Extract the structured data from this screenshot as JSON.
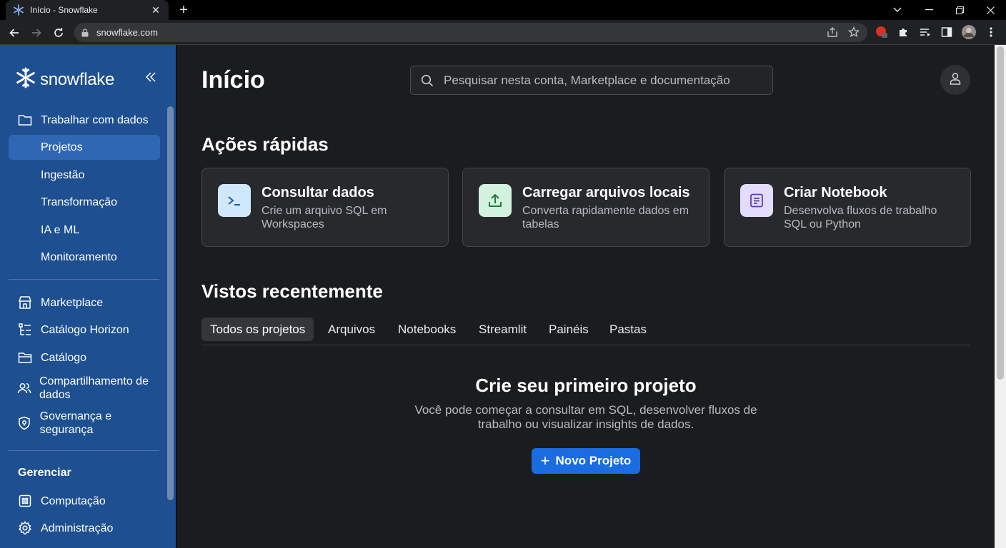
{
  "browser": {
    "tab_title": "Início - Snowflake",
    "url": "snowflake.com"
  },
  "sidebar": {
    "brand": "snowflake",
    "work_with_data": "Trabalhar com dados",
    "sub_items": [
      "Projetos",
      "Ingestão",
      "Transformação",
      "IA e ML",
      "Monitoramento"
    ],
    "items": [
      "Marketplace",
      "Catálogo Horizon",
      "Catálogo",
      "Compartilhamento de dados",
      "Governança e segurança"
    ],
    "manage_label": "Gerenciar",
    "manage_items": [
      "Computação",
      "Administração"
    ]
  },
  "header": {
    "title": "Início",
    "search_placeholder": "Pesquisar nesta conta, Marketplace e documentação"
  },
  "quick_actions": {
    "heading": "Ações rápidas",
    "cards": [
      {
        "title": "Consultar dados",
        "desc": "Crie um arquivo SQL em Workspaces",
        "icon": "terminal-icon",
        "icon_bg": "#cfe8fb",
        "icon_color": "#1f5fa8"
      },
      {
        "title": "Carregar arquivos locais",
        "desc": "Converta rapidamente dados em tabelas",
        "icon": "upload-icon",
        "icon_bg": "#d3f2de",
        "icon_color": "#1f7a45"
      },
      {
        "title": "Criar Notebook",
        "desc": "Desenvolva fluxos de trabalho SQL ou Python",
        "icon": "notebook-icon",
        "icon_bg": "#e3dcfb",
        "icon_color": "#5a3fb0"
      }
    ]
  },
  "recent": {
    "heading": "Vistos recentemente",
    "tabs": [
      "Todos os projetos",
      "Arquivos",
      "Notebooks",
      "Streamlit",
      "Painéis",
      "Pastas"
    ],
    "active_tab": "Todos os projetos",
    "empty_title": "Crie seu primeiro projeto",
    "empty_desc": "Você pode começar a consultar em SQL, desenvolver fluxos de trabalho ou visualizar insights de dados.",
    "new_button": "Novo Projeto"
  },
  "colors": {
    "sidebar_bg": "#1d4f91",
    "active_item": "#2f67b4",
    "primary": "#1a6ce0"
  }
}
